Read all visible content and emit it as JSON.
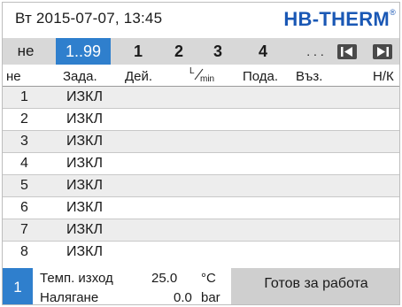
{
  "header": {
    "datetime": "Вт 2015-07-07, 13:45",
    "brand": "HB-THERM",
    "brand_mark": "®"
  },
  "tabs": {
    "first_label": "не",
    "active_label": "1..99",
    "items": [
      "1",
      "2",
      "3",
      "4"
    ],
    "ellipsis": ". . .",
    "prev_icon": "skip-back-icon",
    "next_icon": "skip-forward-icon"
  },
  "table": {
    "headers": {
      "no": "не",
      "setpoint": "Зада.",
      "actual": "Дей.",
      "flow": "L/min",
      "flow_top": "L",
      "flow_bottom": "min",
      "supply": "Пода.",
      "return": "Въз.",
      "hl": "Н/К"
    },
    "rows": [
      {
        "no": "1",
        "setpoint": "ИЗКЛ"
      },
      {
        "no": "2",
        "setpoint": "ИЗКЛ"
      },
      {
        "no": "3",
        "setpoint": "ИЗКЛ"
      },
      {
        "no": "4",
        "setpoint": "ИЗКЛ"
      },
      {
        "no": "5",
        "setpoint": "ИЗКЛ"
      },
      {
        "no": "6",
        "setpoint": "ИЗКЛ"
      },
      {
        "no": "7",
        "setpoint": "ИЗКЛ"
      },
      {
        "no": "8",
        "setpoint": "ИЗКЛ"
      }
    ]
  },
  "footer": {
    "unit_no": "1",
    "temp_label": "Темп. изход",
    "temp_value": "25.0",
    "temp_unit": "°C",
    "pressure_label": "Налягане",
    "pressure_value": "0.0",
    "pressure_unit": "bar",
    "status": "Готов за работа"
  },
  "colors": {
    "accent": "#2f7fcd",
    "brand": "#1a58b5",
    "tab_bar": "#d8d8d8",
    "row_alt": "#ededed",
    "status_bg": "#cfcfcf"
  }
}
